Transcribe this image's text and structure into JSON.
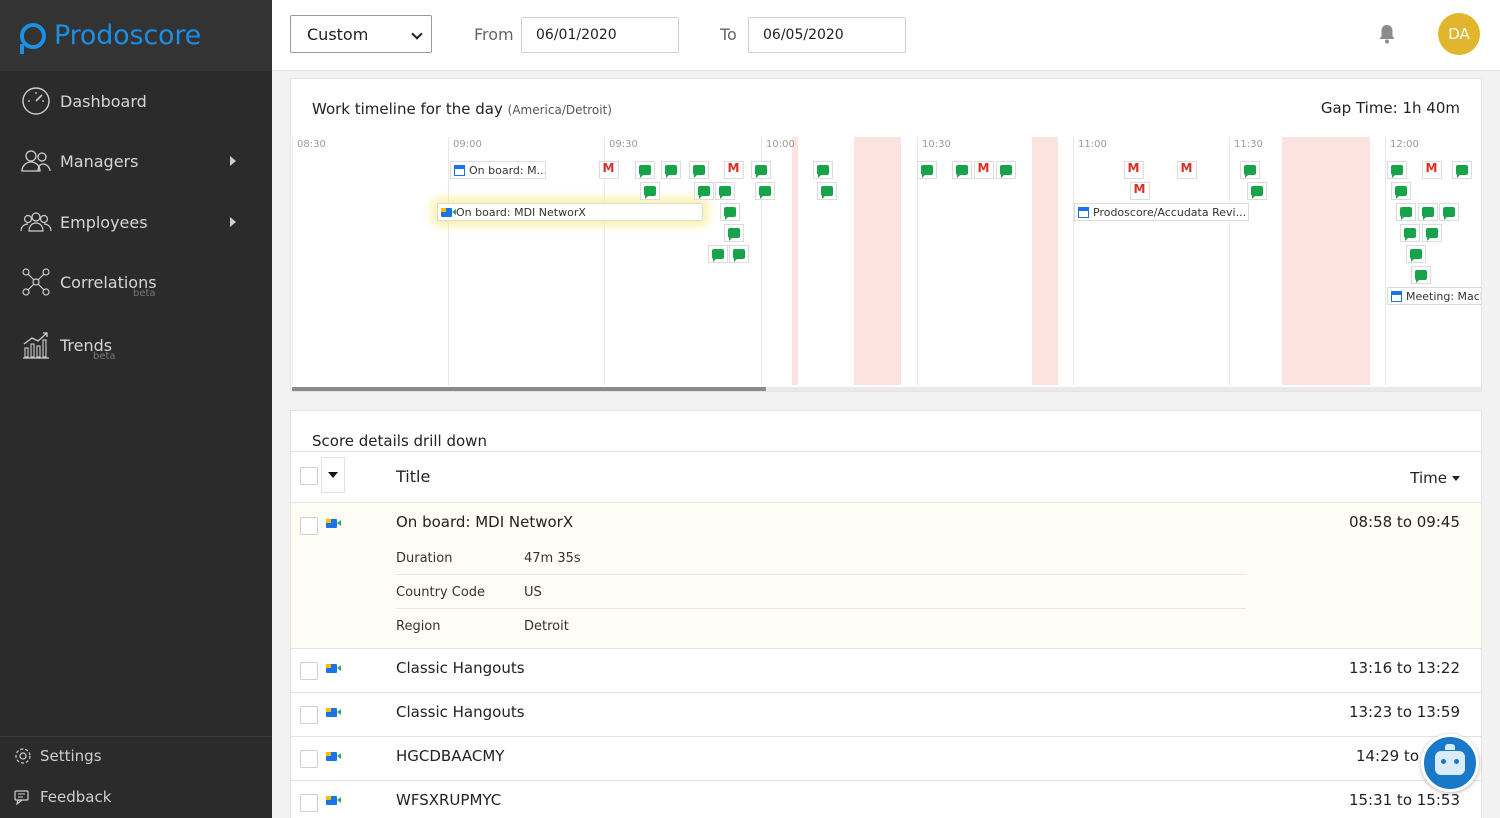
{
  "brand": {
    "name": "Prodoscore",
    "color": "#1a8fe3"
  },
  "sidebar": {
    "items": [
      {
        "label": "Dashboard",
        "icon": "speedometer-icon"
      },
      {
        "label": "Managers",
        "icon": "managers-icon",
        "has_submenu": true
      },
      {
        "label": "Employees",
        "icon": "employees-icon",
        "has_submenu": true
      },
      {
        "label": "Correlations",
        "icon": "correlations-icon",
        "badge": "beta"
      },
      {
        "label": "Trends",
        "icon": "trends-icon",
        "badge": "beta"
      }
    ],
    "bottom": [
      {
        "label": "Settings",
        "icon": "gear-icon"
      },
      {
        "label": "Feedback",
        "icon": "feedback-icon"
      }
    ]
  },
  "topbar": {
    "range_select": "Custom",
    "from_label": "From",
    "from_value": "06/01/2020",
    "to_label": "To",
    "to_value": "06/05/2020",
    "avatar_initials": "DA",
    "avatar_color": "#e2b52e"
  },
  "timeline": {
    "title": "Work timeline for the day",
    "timezone": "(America/Detroit)",
    "gap_time": "Gap Time: 1h 40m",
    "hours": [
      "08:30",
      "09:00",
      "09:30",
      "10:00",
      "10:30",
      "11:00",
      "11:30",
      "12:00"
    ],
    "event_labels": {
      "onboard_short": "On board: M...",
      "onboard_full": "On board: MDI NetworX",
      "accudata": "Prodoscore/Accudata Revi...",
      "meeting": "Meeting: Mach"
    },
    "colors": {
      "chat": "#17a34a",
      "gap": "#fde3e0"
    }
  },
  "score_details": {
    "title": "Score details drill down",
    "columns": {
      "title": "Title",
      "time": "Time"
    },
    "rows": [
      {
        "title": "On board: MDI NetworX",
        "time": "08:58 to 09:45",
        "details": [
          {
            "key": "Duration",
            "value": "47m 35s"
          },
          {
            "key": "Country Code",
            "value": "US"
          },
          {
            "key": "Region",
            "value": "Detroit"
          }
        ]
      },
      {
        "title": "Classic Hangouts",
        "time": "13:16 to 13:22"
      },
      {
        "title": "Classic Hangouts",
        "time": "13:23 to 13:59"
      },
      {
        "title": "HGCDBAACMY",
        "time": "14:29 to"
      },
      {
        "title": "WFSXRUPMYC",
        "time": "15:31 to 15:53"
      }
    ]
  }
}
